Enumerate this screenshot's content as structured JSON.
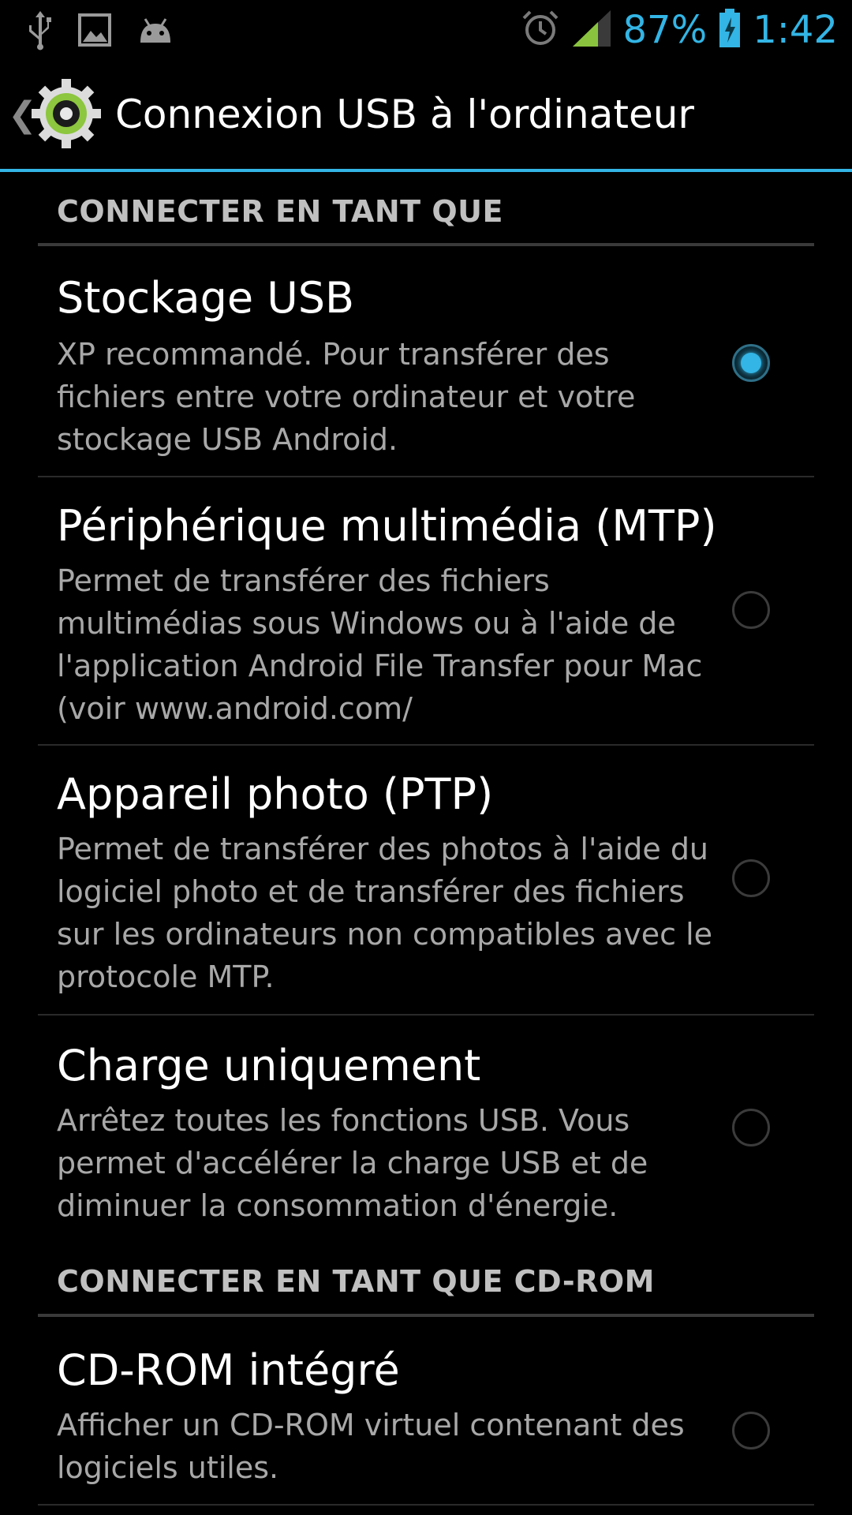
{
  "status_bar": {
    "battery_percent": "87%",
    "time": "1:42",
    "left_icons": [
      "usb-icon",
      "image-icon",
      "android-icon"
    ],
    "right_icons": [
      "alarm-icon",
      "signal-icon",
      "battery-icon"
    ]
  },
  "action_bar": {
    "title": "Connexion USB à l'ordinateur",
    "up_glyph": "❮"
  },
  "sections": [
    {
      "header": "CONNECTER EN TANT QUE",
      "items": [
        {
          "title": "Stockage USB",
          "summary": "XP recommandé. Pour transférer des fichiers entre votre ordinateur et votre stockage USB Android.",
          "checked": true
        },
        {
          "title": "Périphérique multimédia (MTP)",
          "summary": "Permet de transférer des fichiers multimédias sous Windows ou à l'aide de l'application Android File Transfer pour Mac (voir www.android.com/",
          "checked": false
        },
        {
          "title": "Appareil photo (PTP)",
          "summary": "Permet de transférer des photos à l'aide du logiciel photo et de transférer des fichiers sur les ordinateurs non compatibles avec le protocole MTP.",
          "checked": false
        },
        {
          "title": "Charge uniquement",
          "summary": "Arrêtez toutes les fonctions USB. Vous permet d'accélérer la charge USB et de diminuer la consommation d'énergie.",
          "checked": false
        }
      ]
    },
    {
      "header": "CONNECTER EN TANT QUE CD-ROM",
      "items": [
        {
          "title": "CD-ROM intégré",
          "summary": "Afficher un CD-ROM virtuel contenant des logiciels utiles.",
          "checked": false
        }
      ]
    }
  ],
  "colors": {
    "accent": "#33b5e5",
    "background": "#000000",
    "summary_text": "#a8a8a8",
    "header_text": "#c0c0c0"
  }
}
